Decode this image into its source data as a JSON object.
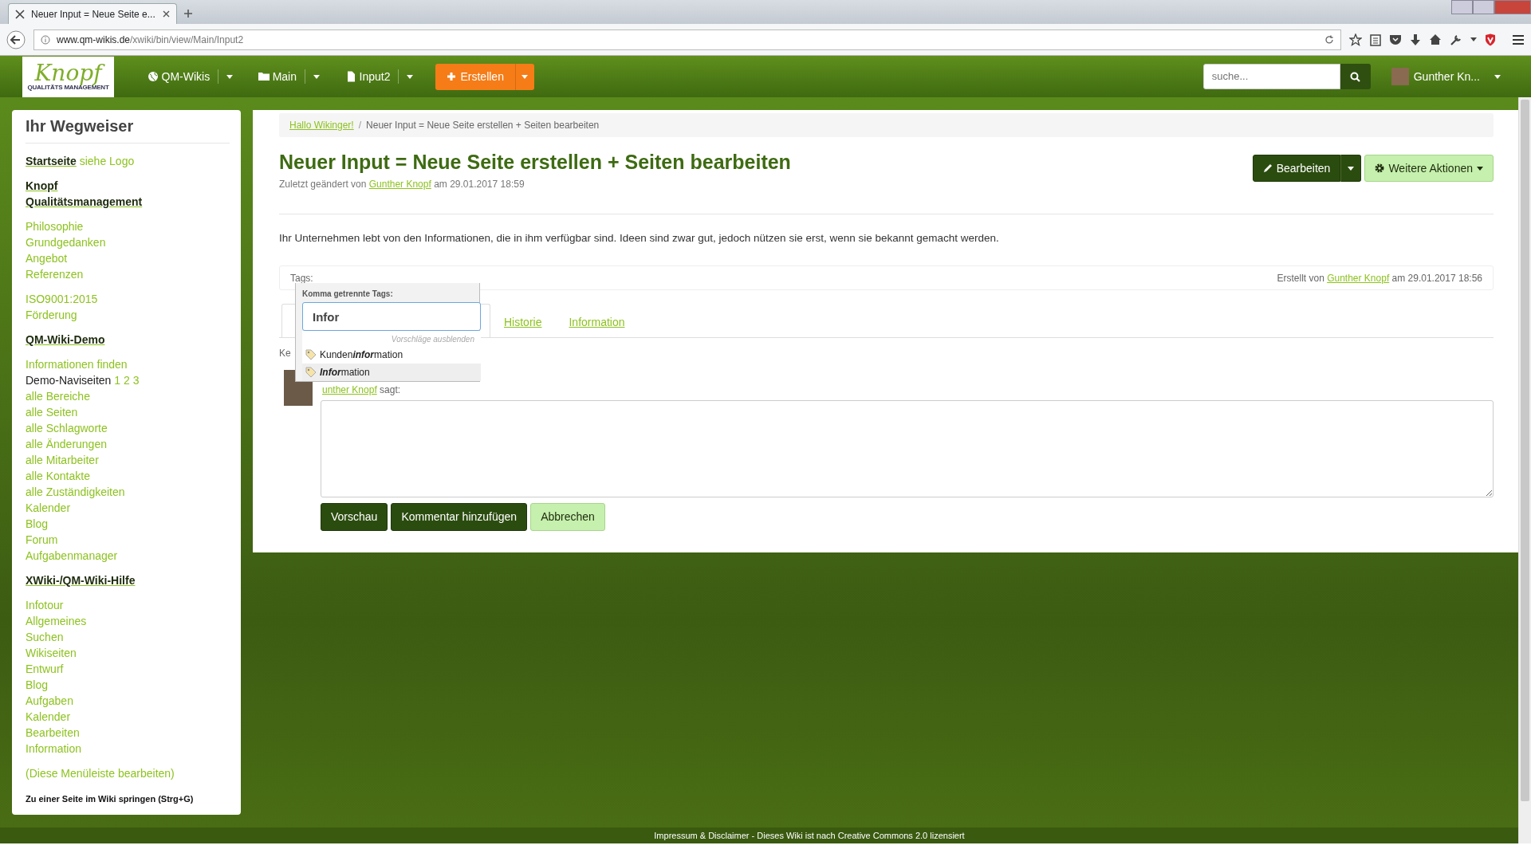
{
  "browser": {
    "tab_title": "Neuer Input = Neue Seite e...",
    "url_domain": "www.qm-wikis.de",
    "url_path": "/xwiki/bin/view/Main/Input2"
  },
  "navbar": {
    "logo": "Knopf",
    "logo_sub": "QUALITÄTS MANAGEMENT",
    "menus": [
      {
        "label": "QM-Wikis"
      },
      {
        "label": "Main"
      },
      {
        "label": "Input2"
      }
    ],
    "create": "Erstellen",
    "search": {
      "placeholder": "suche..."
    },
    "user": "Gunther Kn..."
  },
  "sidebar": {
    "title": "Ihr Wegweiser",
    "groups": [
      {
        "items": [
          [
            {
              "kind": "heading",
              "text": "Startseite"
            },
            {
              "kind": "link",
              "text": "siehe Logo"
            }
          ]
        ]
      },
      {
        "items": [
          [
            {
              "kind": "heading",
              "text": "Knopf"
            }
          ],
          [
            {
              "kind": "heading",
              "text": "Qualitätsmanagement"
            }
          ]
        ]
      },
      {
        "items": [
          [
            {
              "kind": "link",
              "text": "Philosophie"
            }
          ],
          [
            {
              "kind": "link",
              "text": "Grundgedanken"
            }
          ],
          [
            {
              "kind": "link",
              "text": "Angebot"
            }
          ],
          [
            {
              "kind": "link",
              "text": "Referenzen"
            }
          ]
        ]
      },
      {
        "items": [
          [
            {
              "kind": "link",
              "text": "ISO9001:2015"
            }
          ],
          [
            {
              "kind": "link",
              "text": "Förderung"
            }
          ]
        ]
      },
      {
        "items": [
          [
            {
              "kind": "heading",
              "text": "QM-Wiki-Demo"
            }
          ]
        ]
      },
      {
        "items": [
          [
            {
              "kind": "link",
              "text": "Informationen finden"
            }
          ],
          [
            {
              "kind": "text",
              "text": "Demo-Naviseiten"
            },
            {
              "kind": "link",
              "text": "1"
            },
            {
              "kind": "link",
              "text": "2"
            },
            {
              "kind": "link",
              "text": "3"
            }
          ],
          [
            {
              "kind": "link",
              "text": "alle Bereiche"
            }
          ],
          [
            {
              "kind": "link",
              "text": "alle Seiten"
            }
          ],
          [
            {
              "kind": "link",
              "text": "alle Schlagworte"
            }
          ],
          [
            {
              "kind": "link",
              "text": "alle Änderungen"
            }
          ],
          [
            {
              "kind": "link",
              "text": "alle Mitarbeiter"
            }
          ],
          [
            {
              "kind": "link",
              "text": "alle Kontakte"
            }
          ],
          [
            {
              "kind": "link",
              "text": "alle Zuständigkeiten"
            }
          ],
          [
            {
              "kind": "link",
              "text": "Kalender"
            }
          ],
          [
            {
              "kind": "link",
              "text": "Blog"
            }
          ],
          [
            {
              "kind": "link",
              "text": "Forum"
            }
          ],
          [
            {
              "kind": "link",
              "text": "Aufgabenmanager"
            }
          ]
        ]
      },
      {
        "items": [
          [
            {
              "kind": "heading",
              "text": "XWiki-/QM-Wiki-Hilfe"
            }
          ]
        ]
      },
      {
        "items": [
          [
            {
              "kind": "link",
              "text": "Infotour"
            }
          ],
          [
            {
              "kind": "link",
              "text": "Allgemeines"
            }
          ],
          [
            {
              "kind": "link",
              "text": "Suchen"
            }
          ],
          [
            {
              "kind": "link",
              "text": "Wikiseiten"
            }
          ],
          [
            {
              "kind": "link",
              "text": "Entwurf"
            }
          ],
          [
            {
              "kind": "link",
              "text": "Blog"
            }
          ],
          [
            {
              "kind": "link",
              "text": "Aufgaben"
            }
          ],
          [
            {
              "kind": "link",
              "text": "Kalender"
            }
          ],
          [
            {
              "kind": "link",
              "text": "Bearbeiten"
            }
          ],
          [
            {
              "kind": "link",
              "text": "Information"
            }
          ]
        ]
      },
      {
        "items": [
          [
            {
              "kind": "link",
              "text": "(Diese Menüleiste bearbeiten)"
            }
          ]
        ]
      },
      {
        "items": [
          [
            {
              "kind": "hint",
              "text": "Zu einer Seite im Wiki springen (Strg+G)"
            }
          ]
        ]
      }
    ]
  },
  "breadcrumb": {
    "separator": "/",
    "items": [
      {
        "label": "Hallo Wikinger!",
        "kind": "link"
      },
      {
        "label": "Neuer Input = Neue Seite erstellen + Seiten bearbeiten",
        "kind": "current"
      }
    ]
  },
  "page": {
    "title": "Neuer Input = Neue Seite erstellen + Seiten bearbeiten",
    "meta_prefix": "Zuletzt geändert von",
    "meta_author": "Gunther Knopf",
    "meta_date": "am 29.01.2017 18:59",
    "edit_button": "Bearbeiten",
    "more_button": "Weitere Aktionen",
    "body": "Ihr Unternehmen lebt von den Informationen, die in ihm verfügbar sind. Ideen sind zwar gut, jedoch nützen sie erst, wenn sie bekannt gemacht werden."
  },
  "tags": {
    "label": "Tags:",
    "created_prefix": "Erstellt von",
    "created_author": "Gunther Knopf",
    "created_date": "am 29.01.2017 18:56",
    "popup": {
      "label": "Komma getrennte Tags:",
      "value": "Infor",
      "hide_link": "Vorschläge ausblenden",
      "suggestions": [
        {
          "text": "Kunden**infor**mation",
          "selected": false
        },
        {
          "text": "**Infor**mation",
          "selected": true
        }
      ]
    }
  },
  "tabs": [
    {
      "label": "Historie",
      "selected": false
    },
    {
      "label": "Information",
      "selected": false
    }
  ],
  "comments": {
    "heading": "Ke",
    "author": "unther Knopf",
    "says": "sagt:",
    "buttons": [
      {
        "label": "Vorschau",
        "kind": "primary"
      },
      {
        "label": "Kommentar hinzufügen",
        "kind": "primary"
      },
      {
        "label": "Abbrechen",
        "kind": "secondary"
      }
    ]
  },
  "footer": "Impressum & Disclaimer - Dieses Wiki ist nach Creative Commons 2.0 lizensiert"
}
